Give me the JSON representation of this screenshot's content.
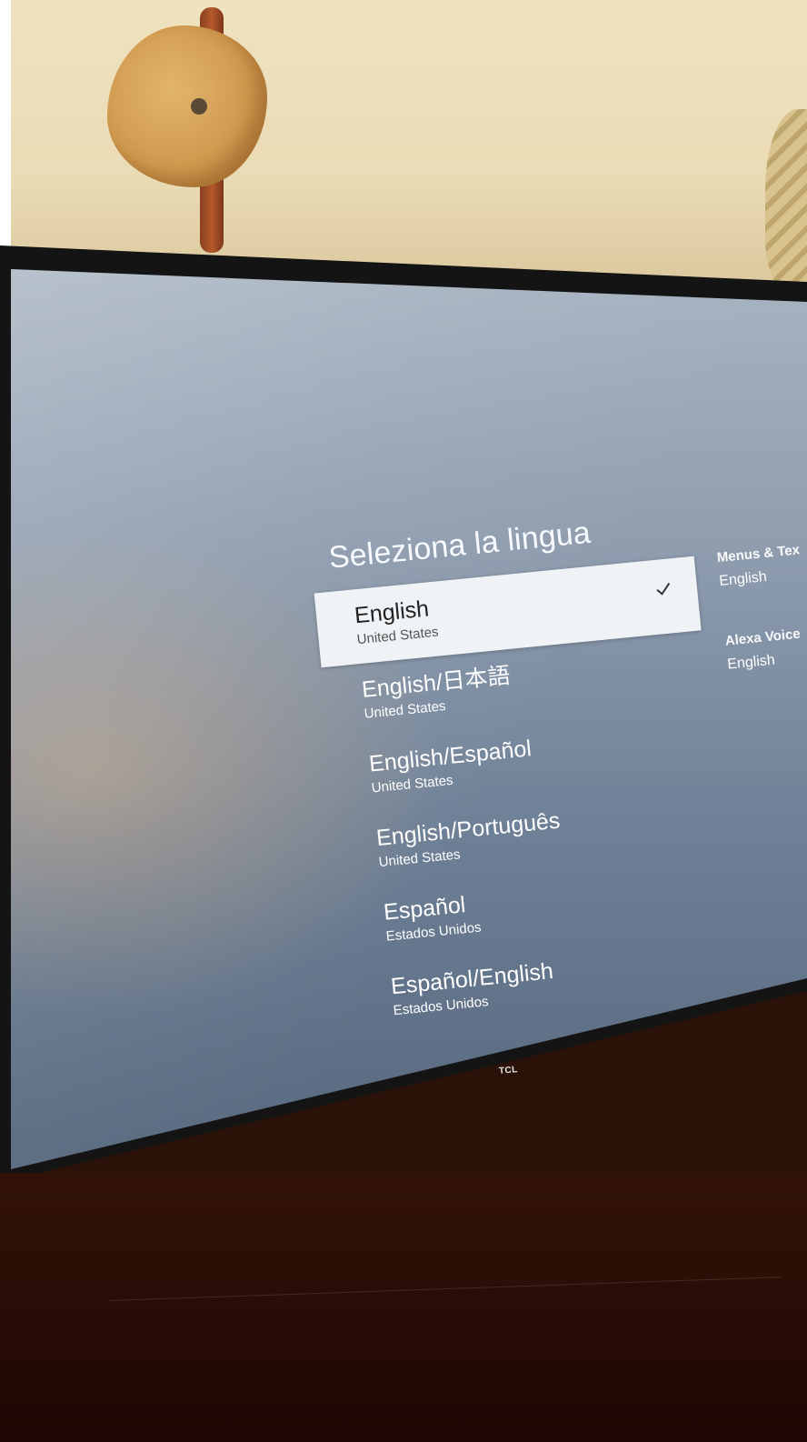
{
  "screen": {
    "title": "Seleziona la lingua",
    "brand": "TCL",
    "languages": [
      {
        "name": "English",
        "region": "United States",
        "selected": true
      },
      {
        "name": "English/日本語",
        "region": "United States",
        "selected": false
      },
      {
        "name": "English/Español",
        "region": "United States",
        "selected": false
      },
      {
        "name": "English/Português",
        "region": "United States",
        "selected": false
      },
      {
        "name": "Español",
        "region": "Estados Unidos",
        "selected": false
      },
      {
        "name": "Español/English",
        "region": "Estados Unidos",
        "selected": false
      }
    ],
    "side_panel": [
      {
        "title": "Menus & Tex",
        "value": "English"
      },
      {
        "title": "Alexa Voice",
        "value": "English"
      }
    ]
  }
}
